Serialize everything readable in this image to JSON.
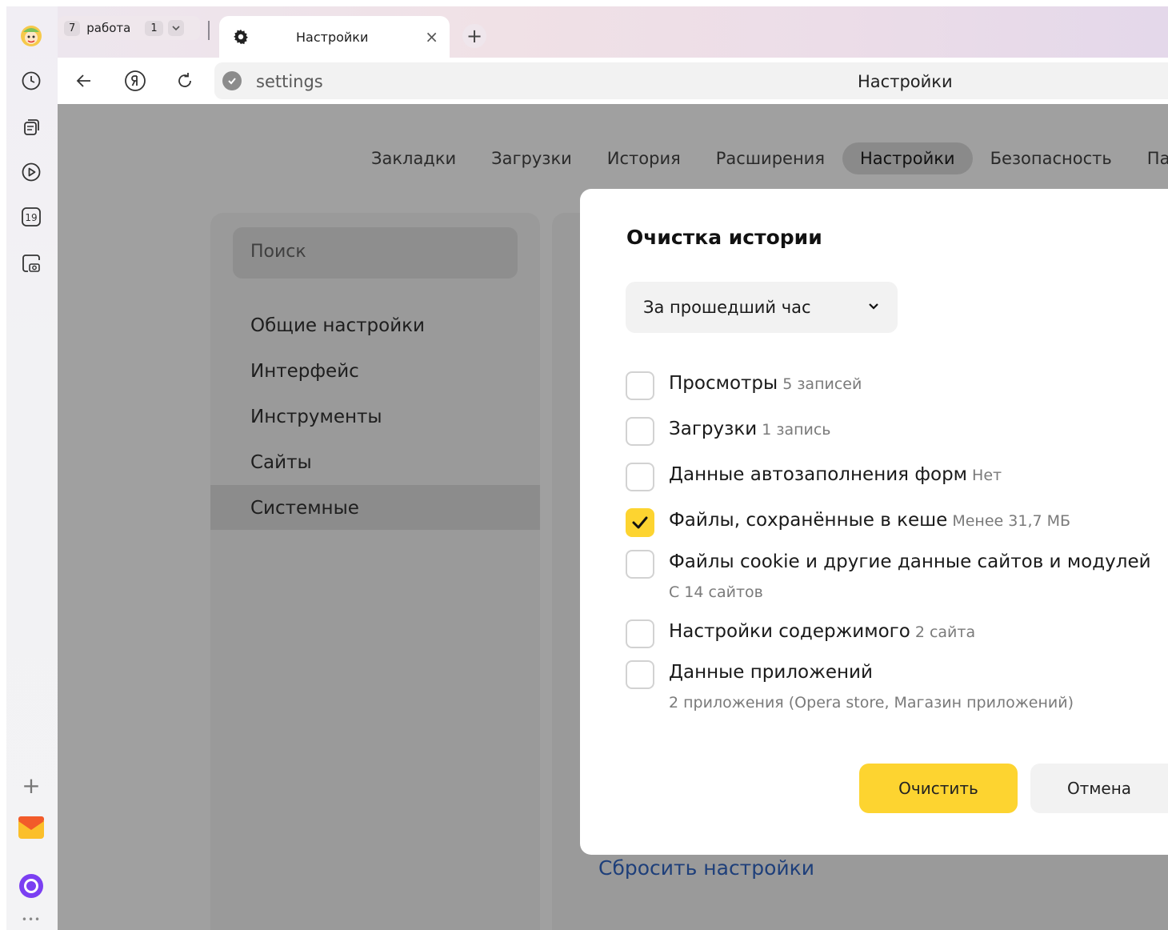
{
  "tabbar": {
    "workspace_number": "7",
    "workspace_label": "работа",
    "workspace_tab_count": "1",
    "active_tab_title": "Настройки",
    "close_glyph": "×",
    "new_tab_glyph": "+"
  },
  "addressbar": {
    "url": "settings",
    "page_title": "Настройки"
  },
  "sidebar": {
    "calendar_day": "19",
    "add_glyph": "+",
    "more_glyph": "•••"
  },
  "topnav": {
    "items": [
      "Закладки",
      "Загрузки",
      "История",
      "Расширения",
      "Настройки",
      "Безопасность",
      "Пароли"
    ],
    "active": "Настройки"
  },
  "settings_menu": {
    "search_placeholder": "Поиск",
    "items": [
      "Общие настройки",
      "Интерфейс",
      "Инструменты",
      "Сайты",
      "Системные"
    ],
    "active": "Системные"
  },
  "main": {
    "reset_link": "Сбросить настройки"
  },
  "dialog": {
    "title": "Очистка истории",
    "period": "За прошедший час",
    "options": [
      {
        "label": "Просмотры",
        "meta": "5 записей",
        "checked": false
      },
      {
        "label": "Загрузки",
        "meta": "1 запись",
        "checked": false
      },
      {
        "label": "Данные автозаполнения форм",
        "meta": "Нет",
        "checked": false
      },
      {
        "label": "Файлы, сохранённые в кеше",
        "meta": "Менее 31,7 МБ",
        "checked": true
      },
      {
        "label": "Файлы cookie и другие данные сайтов и модулей",
        "sub": "С 14 сайтов",
        "checked": false
      },
      {
        "label": "Настройки содержимого",
        "meta": "2 сайта",
        "checked": false
      },
      {
        "label": "Данные приложений",
        "sub": "2 приложения (Opera store, Магазин приложений)",
        "checked": false
      }
    ],
    "clear_button": "Очистить",
    "cancel_button": "Отмена"
  },
  "colors": {
    "accent_yellow": "#fdd430",
    "overlay_gray": "#a0a0a0",
    "link_blue": "#1e3f7a"
  }
}
